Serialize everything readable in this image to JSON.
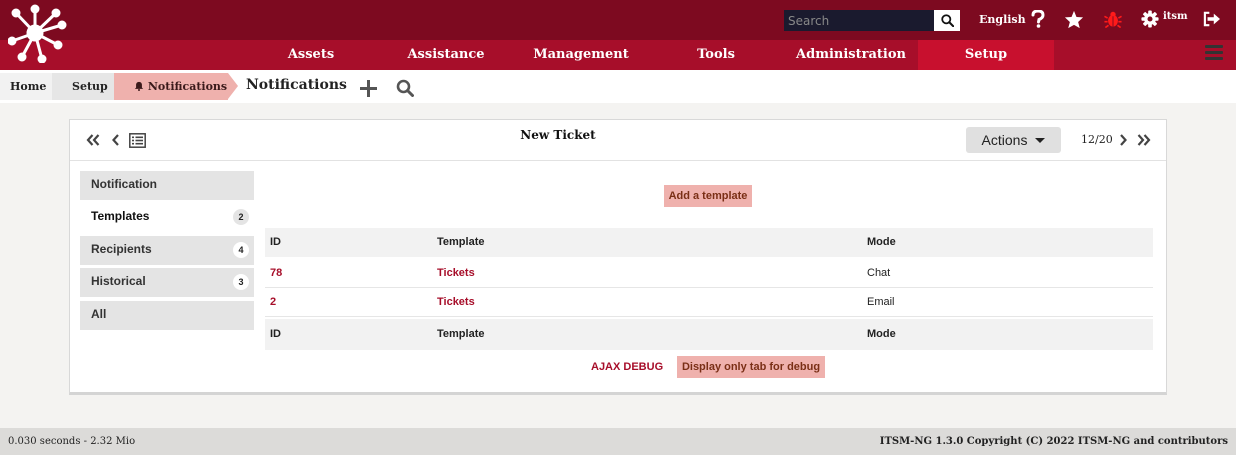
{
  "header": {
    "logo": "itsm-ng-logo",
    "search_placeholder": "Search",
    "language": "English",
    "username": "itsm",
    "icons": [
      "search-icon",
      "help-icon",
      "star-icon",
      "bug-icon",
      "gear-icon",
      "logout-icon"
    ]
  },
  "menu": {
    "items": [
      {
        "label": "Assets"
      },
      {
        "label": "Assistance"
      },
      {
        "label": "Management"
      },
      {
        "label": "Tools"
      },
      {
        "label": "Administration"
      },
      {
        "label": "Setup",
        "active": true
      }
    ]
  },
  "breadcrumb": {
    "items": [
      {
        "label": "Home"
      },
      {
        "label": "Setup"
      },
      {
        "label": "Notifications",
        "icon": "bell-icon"
      }
    ],
    "title": "Notifications"
  },
  "panel": {
    "title": "New Ticket",
    "actions_label": "Actions",
    "pager": "12/20",
    "tabs": [
      {
        "label": "Notification",
        "count": ""
      },
      {
        "label": "Templates",
        "count": "2",
        "active": true
      },
      {
        "label": "Recipients",
        "count": "4"
      },
      {
        "label": "Historical",
        "count": "3"
      },
      {
        "label": "All",
        "count": ""
      }
    ],
    "add_template_label": "Add a template",
    "table": {
      "headers": [
        "ID",
        "Template",
        "Mode"
      ],
      "rows": [
        [
          "78",
          "Tickets",
          "Chat"
        ],
        [
          "2",
          "Tickets",
          "Email"
        ]
      ],
      "footers": [
        "ID",
        "Template",
        "Mode"
      ]
    },
    "ajax_debug_label": "AJAX DEBUG",
    "debug_tab_label": "Display only tab for debug"
  },
  "footer": {
    "timing": "0.030 seconds - 2.32 Mio",
    "copyright": "ITSM-NG 1.3.0 Copyright (C) 2022 ITSM-NG and contributors"
  },
  "colors": {
    "topbar": "#7d0a20",
    "menubar": "#a70e2a",
    "menu_active": "#c8102e",
    "accent_salmon": "#efb1ad",
    "link": "#a70e2a"
  }
}
